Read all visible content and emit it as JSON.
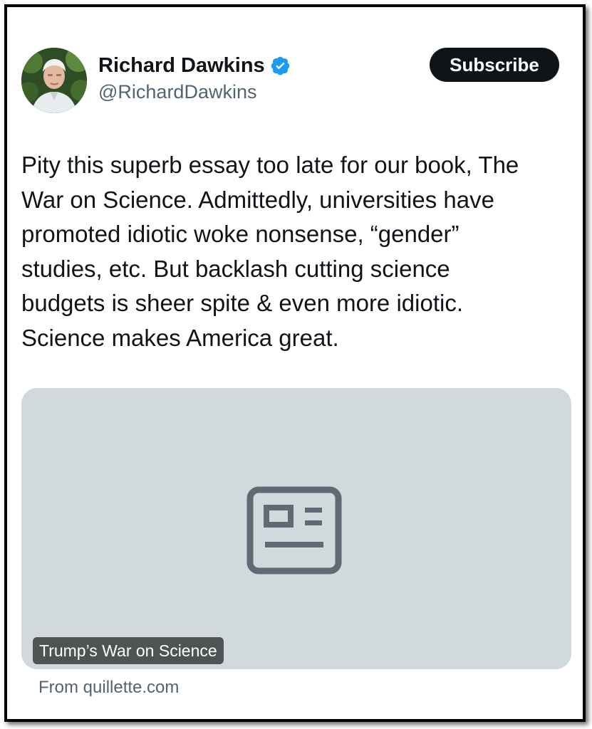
{
  "author": {
    "display_name": "Richard Dawkins",
    "handle": "@RichardDawkins",
    "verified": true,
    "verified_color": "#1d9bf0",
    "avatar_icon": "profile-photo"
  },
  "actions": {
    "subscribe_label": "Subscribe"
  },
  "tweet": {
    "lines": [
      "Pity this superb essay too late for our book, The",
      "War on Science. Admittedly, universities have",
      "promoted idiotic woke nonsense, “gender”",
      "studies, etc. But backlash cutting science",
      "budgets is sheer spite & even more idiotic.",
      "Science makes America great."
    ]
  },
  "link_card": {
    "title": "Trump’s War on Science",
    "source": "From quillette.com",
    "icon": "article-icon",
    "background_color": "#d1d9dd"
  },
  "colors": {
    "text_primary": "#0f1419",
    "text_secondary": "#536471",
    "button_bg": "#0f1419"
  }
}
